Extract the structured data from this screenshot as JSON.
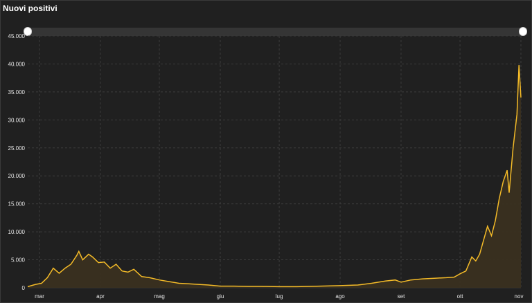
{
  "colors": {
    "background": "#202020",
    "line": "#f4bb28",
    "area": "#3a3020",
    "grid": "#3c3c3c"
  },
  "chart_data": {
    "type": "area",
    "title": "Nuovi positivi",
    "xlabel": "",
    "ylabel": "",
    "ylim": [
      0,
      45000
    ],
    "yticks": [
      0,
      5000,
      10000,
      15000,
      20000,
      25000,
      30000,
      35000,
      40000,
      45000
    ],
    "ytick_labels": [
      "0",
      "5.000",
      "10.000",
      "15.000",
      "20.000",
      "25.000",
      "30.000",
      "35.000",
      "40.000",
      "45.000"
    ],
    "xlim": [
      "2020-02-24",
      "2020-11-01"
    ],
    "xticks": [
      "2020-03-01",
      "2020-04-01",
      "2020-05-01",
      "2020-06-01",
      "2020-07-01",
      "2020-08-01",
      "2020-09-01",
      "2020-10-01",
      "2020-11-01"
    ],
    "xtick_labels": [
      "mar",
      "apr",
      "mag",
      "giu",
      "lug",
      "ago",
      "set",
      "ott",
      "nov"
    ],
    "grid": true,
    "legend": "none",
    "series": [
      {
        "x": [
          "2020-02-24",
          "2020-02-28",
          "2020-03-02",
          "2020-03-05",
          "2020-03-08",
          "2020-03-11",
          "2020-03-14",
          "2020-03-17",
          "2020-03-20",
          "2020-03-21",
          "2020-03-23",
          "2020-03-26",
          "2020-03-28",
          "2020-03-31",
          "2020-04-03",
          "2020-04-06",
          "2020-04-09",
          "2020-04-12",
          "2020-04-15",
          "2020-04-18",
          "2020-04-22",
          "2020-04-26",
          "2020-05-01",
          "2020-05-06",
          "2020-05-11",
          "2020-05-16",
          "2020-05-21",
          "2020-05-26",
          "2020-06-01",
          "2020-06-08",
          "2020-06-15",
          "2020-06-22",
          "2020-07-01",
          "2020-07-10",
          "2020-07-20",
          "2020-08-01",
          "2020-08-10",
          "2020-08-17",
          "2020-08-24",
          "2020-08-29",
          "2020-09-01",
          "2020-09-06",
          "2020-09-12",
          "2020-09-18",
          "2020-09-24",
          "2020-09-28",
          "2020-10-01",
          "2020-10-04",
          "2020-10-07",
          "2020-10-09",
          "2020-10-11",
          "2020-10-13",
          "2020-10-15",
          "2020-10-17",
          "2020-10-19",
          "2020-10-21",
          "2020-10-23",
          "2020-10-25",
          "2020-10-26",
          "2020-10-28",
          "2020-10-30",
          "2020-10-31",
          "2020-11-01"
        ],
        "values": [
          200,
          600,
          800,
          1800,
          3500,
          2600,
          3500,
          4200,
          5800,
          6500,
          5000,
          6000,
          5500,
          4500,
          4600,
          3500,
          4200,
          3000,
          2800,
          3300,
          2000,
          1800,
          1400,
          1100,
          800,
          700,
          600,
          500,
          300,
          300,
          250,
          250,
          200,
          200,
          280,
          380,
          500,
          800,
          1200,
          1400,
          1000,
          1400,
          1600,
          1700,
          1800,
          1900,
          2500,
          3000,
          5500,
          4800,
          6000,
          8500,
          11000,
          9300,
          12000,
          16000,
          19000,
          21000,
          17000,
          25000,
          31000,
          39800,
          34000
        ]
      }
    ]
  }
}
